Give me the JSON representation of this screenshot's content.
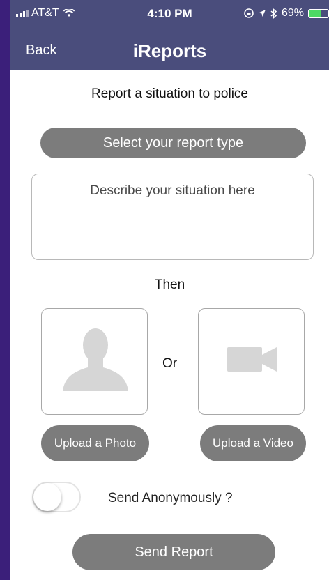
{
  "status_bar": {
    "carrier": "AT&T",
    "time": "4:10 PM",
    "battery": "69%",
    "battery_level": 0.69
  },
  "nav": {
    "back_label": "Back",
    "title": "iReports"
  },
  "form": {
    "subtitle": "Report a situation to police",
    "select_type_label": "Select your report type",
    "description_placeholder": "Describe your situation here",
    "then_label": "Then",
    "or_label": "Or",
    "upload_photo_label": "Upload a Photo",
    "upload_video_label": "Upload a Video",
    "anonymous_label": "Send Anonymously ?",
    "anonymous_enabled": false,
    "send_label": "Send Report"
  },
  "colors": {
    "header": "#4a4d7c",
    "button": "#7c7c7c",
    "background_outer": "#3b1f7a"
  }
}
